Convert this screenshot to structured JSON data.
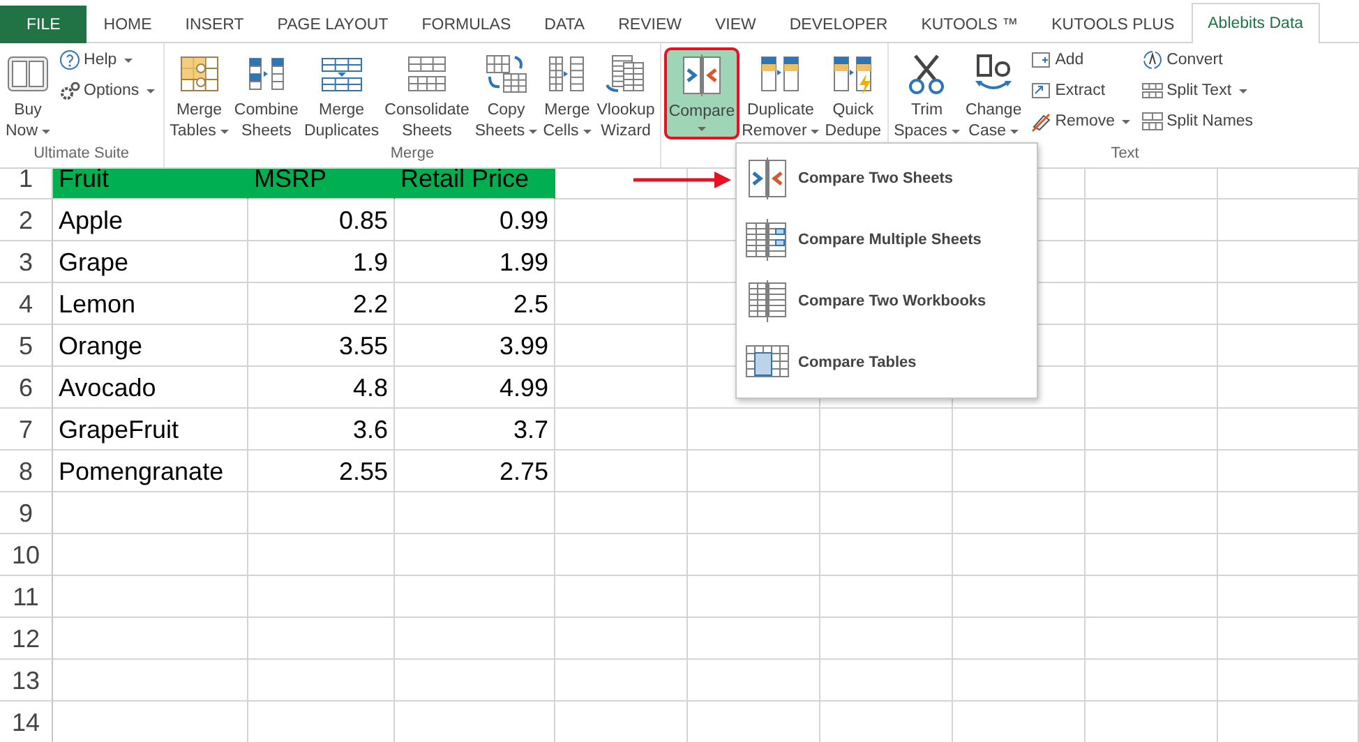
{
  "tabs": [
    {
      "label": "FILE",
      "kind": "file",
      "selected": false
    },
    {
      "label": "HOME",
      "kind": "tab",
      "selected": false
    },
    {
      "label": "INSERT",
      "kind": "tab",
      "selected": false
    },
    {
      "label": "PAGE LAYOUT",
      "kind": "tab",
      "selected": false
    },
    {
      "label": "FORMULAS",
      "kind": "tab",
      "selected": false
    },
    {
      "label": "DATA",
      "kind": "tab",
      "selected": false
    },
    {
      "label": "REVIEW",
      "kind": "tab",
      "selected": false
    },
    {
      "label": "VIEW",
      "kind": "tab",
      "selected": false
    },
    {
      "label": "DEVELOPER",
      "kind": "tab",
      "selected": false
    },
    {
      "label": "KUTOOLS ™",
      "kind": "tab",
      "selected": false
    },
    {
      "label": "KUTOOLS PLUS",
      "kind": "tab",
      "selected": false
    },
    {
      "label": "Ablebits Data",
      "kind": "tab",
      "selected": true
    }
  ],
  "ribbon": {
    "groups": [
      {
        "label": "Ultimate Suite",
        "items": [
          {
            "kind": "large",
            "lines": [
              "Buy",
              "Now"
            ],
            "dropdown": true,
            "selected": false
          },
          {
            "kind": "stack",
            "entries": [
              {
                "label": "Help",
                "dropdown": true
              },
              {
                "label": "Options",
                "dropdown": true
              }
            ]
          }
        ]
      },
      {
        "label": "Merge",
        "items": [
          {
            "kind": "large",
            "lines": [
              "Merge",
              "Tables"
            ],
            "dropdown": true,
            "selected": false
          },
          {
            "kind": "large",
            "lines": [
              "Combine",
              "Sheets"
            ],
            "dropdown": false,
            "selected": false
          },
          {
            "kind": "large",
            "lines": [
              "Merge",
              "Duplicates"
            ],
            "dropdown": false,
            "selected": false
          },
          {
            "kind": "large",
            "lines": [
              "Consolidate",
              "Sheets"
            ],
            "dropdown": false,
            "selected": false
          },
          {
            "kind": "large",
            "lines": [
              "Copy",
              "Sheets"
            ],
            "dropdown": true,
            "selected": false
          },
          {
            "kind": "large",
            "lines": [
              "Merge",
              "Cells"
            ],
            "dropdown": true,
            "selected": false
          },
          {
            "kind": "large",
            "lines": [
              "Vlookup",
              "Wizard"
            ],
            "dropdown": false,
            "selected": false
          }
        ]
      },
      {
        "items": [
          {
            "kind": "large",
            "lines": [
              "Compare"
            ],
            "dropdown": true,
            "selected": true
          },
          {
            "kind": "large",
            "lines": [
              "Duplicate",
              "Remover"
            ],
            "dropdown": true,
            "selected": false
          },
          {
            "kind": "large",
            "lines": [
              "Quick",
              "Dedupe"
            ],
            "dropdown": false,
            "selected": false
          }
        ]
      },
      {
        "label": "Text",
        "items": [
          {
            "kind": "large",
            "lines": [
              "Trim",
              "Spaces"
            ],
            "dropdown": true,
            "selected": false
          },
          {
            "kind": "large",
            "lines": [
              "Change",
              "Case"
            ],
            "dropdown": true,
            "selected": false
          },
          {
            "kind": "stack",
            "entries": [
              {
                "label": "Add",
                "dropdown": false
              },
              {
                "label": "Extract",
                "dropdown": false
              },
              {
                "label": "Remove",
                "dropdown": true
              }
            ]
          },
          {
            "kind": "stack",
            "entries": [
              {
                "label": "Convert",
                "dropdown": false
              },
              {
                "label": "Split Text",
                "dropdown": true
              },
              {
                "label": "Split Names",
                "dropdown": false
              }
            ]
          }
        ]
      }
    ]
  },
  "compare_menu": {
    "items": [
      {
        "label": "Compare Two Sheets"
      },
      {
        "label": "Compare Multiple Sheets"
      },
      {
        "label": "Compare Two Workbooks"
      },
      {
        "label": "Compare Tables"
      }
    ]
  },
  "sheet": {
    "rows": [
      {
        "number": "1",
        "kind": "header",
        "cells": [
          "Fruit",
          "MSRP",
          "Retail Price"
        ]
      },
      {
        "number": "2",
        "kind": "data",
        "cells": [
          "Apple",
          "0.85",
          "0.99"
        ]
      },
      {
        "number": "3",
        "kind": "data",
        "cells": [
          "Grape",
          "1.9",
          "1.99"
        ]
      },
      {
        "number": "4",
        "kind": "data",
        "cells": [
          "Lemon",
          "2.2",
          "2.5"
        ]
      },
      {
        "number": "5",
        "kind": "data",
        "cells": [
          "Orange",
          "3.55",
          "3.99"
        ]
      },
      {
        "number": "6",
        "kind": "data",
        "cells": [
          "Avocado",
          "4.8",
          "4.99"
        ]
      },
      {
        "number": "7",
        "kind": "data",
        "cells": [
          "GrapeFruit",
          "3.6",
          "3.7"
        ]
      },
      {
        "number": "8",
        "kind": "data",
        "cells": [
          "Pomengranate",
          "2.55",
          "2.75"
        ]
      },
      {
        "number": "9",
        "kind": "data",
        "cells": []
      },
      {
        "number": "10",
        "kind": "data",
        "cells": []
      },
      {
        "number": "11",
        "kind": "data",
        "cells": []
      },
      {
        "number": "12",
        "kind": "data",
        "cells": []
      },
      {
        "number": "13",
        "kind": "data",
        "cells": []
      },
      {
        "number": "14",
        "kind": "data",
        "cells": []
      }
    ]
  }
}
